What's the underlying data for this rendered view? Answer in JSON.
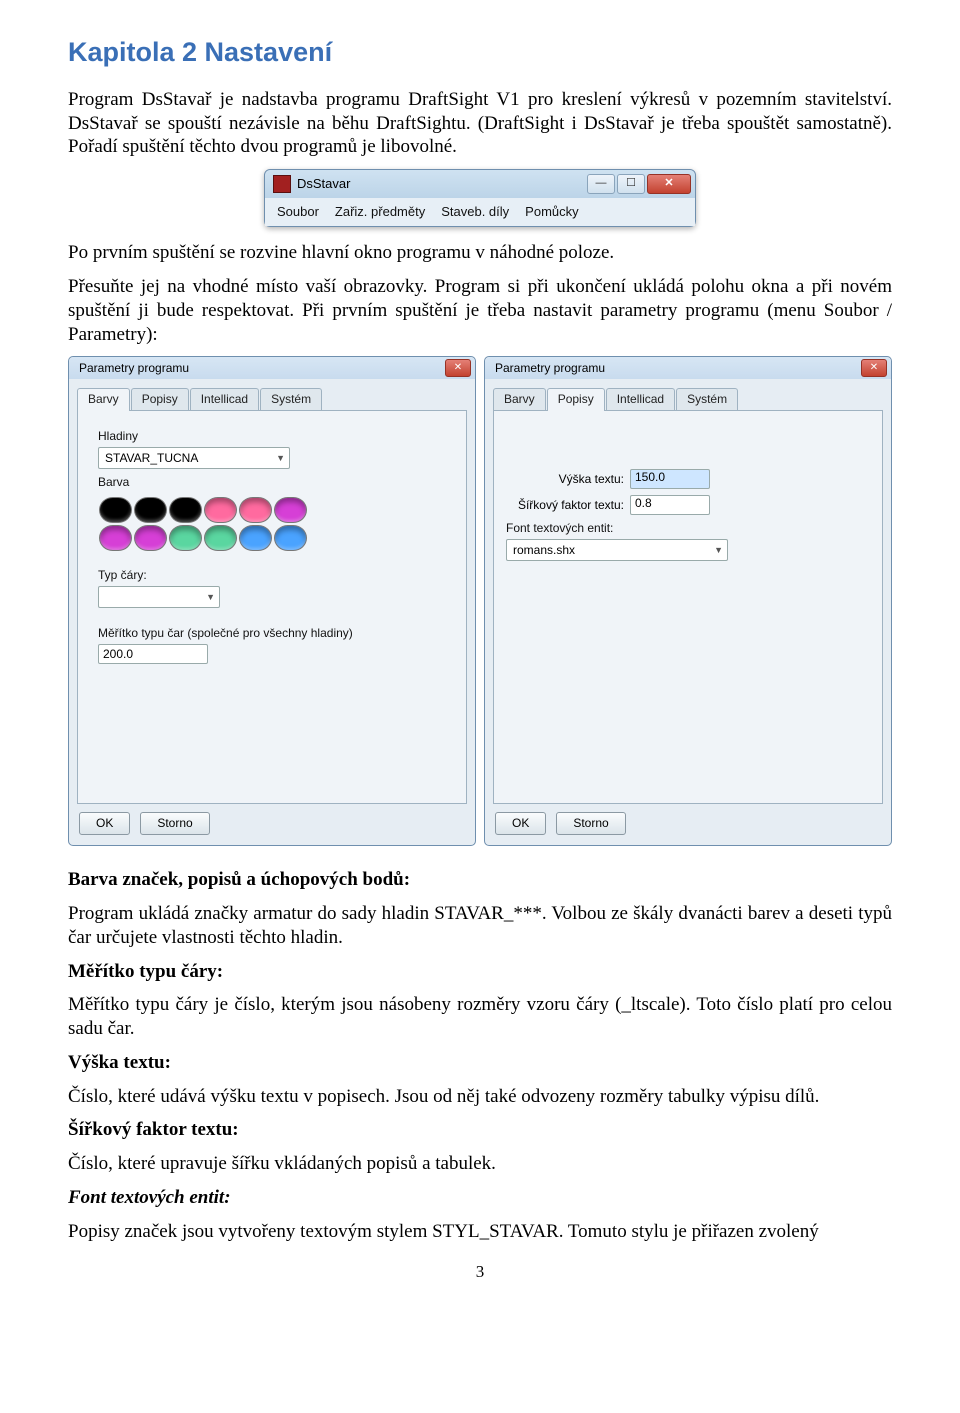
{
  "heading": "Kapitola 2  Nastavení",
  "para1": "Program  DsStavař je nadstavba programu DraftSight V1 pro kreslení výkresů v pozemním stavitelství. DsStavař se spouští nezávisle na běhu DraftSightu. (DraftSight  i DsStavař je třeba spouštět samostatně). Pořadí spuštění těchto dvou programů je libovolné.",
  "small_window": {
    "title": "DsStavar",
    "menu": [
      "Soubor",
      "Zařiz. předměty",
      "Staveb. díly",
      "Pomůcky"
    ]
  },
  "para2": "Po prvním spuštění se rozvine hlavní okno programu v náhodné poloze.",
  "para3": "Přesuňte jej na vhodné místo vaší obrazovky.  Program  si při ukončení ukládá polohu okna a při novém  spuštění ji bude respektovat.  Při   prvním spuštění je třeba   nastavit parametry programu (menu Soubor /  Parametry):",
  "dialog": {
    "title": "Parametry programu",
    "tabs": [
      "Barvy",
      "Popisy",
      "Intellicad",
      "Systém"
    ],
    "left": {
      "activeTab": "Barvy",
      "hladiny_label": "Hladiny",
      "hladiny_value": "STAVAR_TUCNA",
      "barva_label": "Barva",
      "typ_cary_label": "Typ čáry:",
      "meritko_label": "Měřítko typu čar (společné pro všechny hladiny)",
      "meritko_value": "200.0",
      "swatch_colors": [
        [
          "#000000",
          "#000000",
          "#000000",
          "#ff6a9f",
          "#ff6a9f",
          "#d63fd6"
        ],
        [
          "#d63fd6",
          "#d63fd6",
          "#5ad6a0",
          "#5ad6a0",
          "#4aa3ff",
          "#4aa3ff"
        ]
      ]
    },
    "right": {
      "activeTab": "Popisy",
      "row1_label": "Výška textu:",
      "row1_value": "150.0",
      "row2_label": "Šířkový faktor textu:",
      "row2_value": "0.8",
      "row3_label": "Font textových entit:",
      "font_value": "romans.shx"
    },
    "ok": "OK",
    "storno": "Storno"
  },
  "s1_h": "Barva značek, popisů a úchopových bodů:",
  "s1_p": "Program ukládá značky armatur do sady hladin STAVAR_***. Volbou ze škály dvanácti barev a deseti typů čar určujete vlastnosti těchto hladin.",
  "s2_h": "Měřítko typu čáry:",
  "s2_p": "Měřítko typu čáry je číslo, kterým jsou násobeny rozměry vzoru čáry (_ltscale). Toto číslo platí pro celou sadu čar.",
  "s3_h": "Výška textu:",
  "s3_p": "Číslo, které udává výšku textu v popisech. Jsou od něj také odvozeny rozměry tabulky výpisu dílů.",
  "s4_h": "Šířkový faktor textu:",
  "s4_p": "Číslo, které upravuje šířku vkládaných popisů a tabulek.",
  "s5_h": "Font textových entit:",
  "s5_p": "Popisy značek jsou vytvořeny textovým stylem STYL_STAVAR. Tomuto stylu je přiřazen zvolený",
  "pagenum": "3"
}
